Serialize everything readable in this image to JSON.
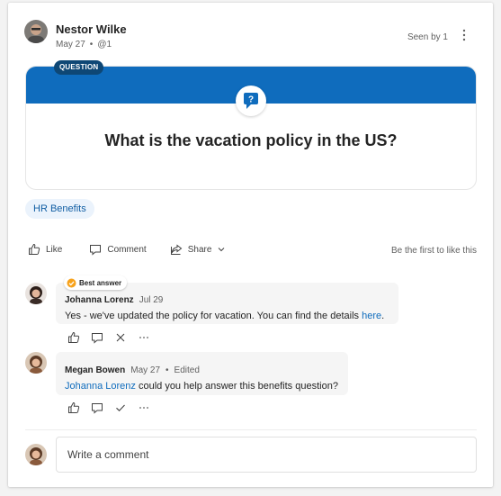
{
  "post": {
    "author": "Nestor Wilke",
    "date": "May 27",
    "mention": "@1",
    "seen": "Seen by 1",
    "badge": "QUESTION",
    "question": "What is the vacation policy in the US?",
    "topic": "HR Benefits"
  },
  "actions": {
    "like": "Like",
    "comment": "Comment",
    "share": "Share",
    "first_like": "Be the first to like this"
  },
  "replies": [
    {
      "best_label": "Best answer",
      "author": "Johanna Lorenz",
      "time": "Jul 29",
      "text": "Yes - we've updated the policy for vacation. You can find the details ",
      "link": "here",
      "after_link": "."
    },
    {
      "author": "Megan Bowen",
      "time": "May 27",
      "edited": "Edited",
      "mention": "Johanna Lorenz",
      "text": " could you help answer this benefits question?"
    }
  ],
  "composer": {
    "placeholder": "Write a comment"
  },
  "colors": {
    "accent": "#0f6cbd",
    "badge": "#0e4775",
    "best": "#f7a21b"
  }
}
